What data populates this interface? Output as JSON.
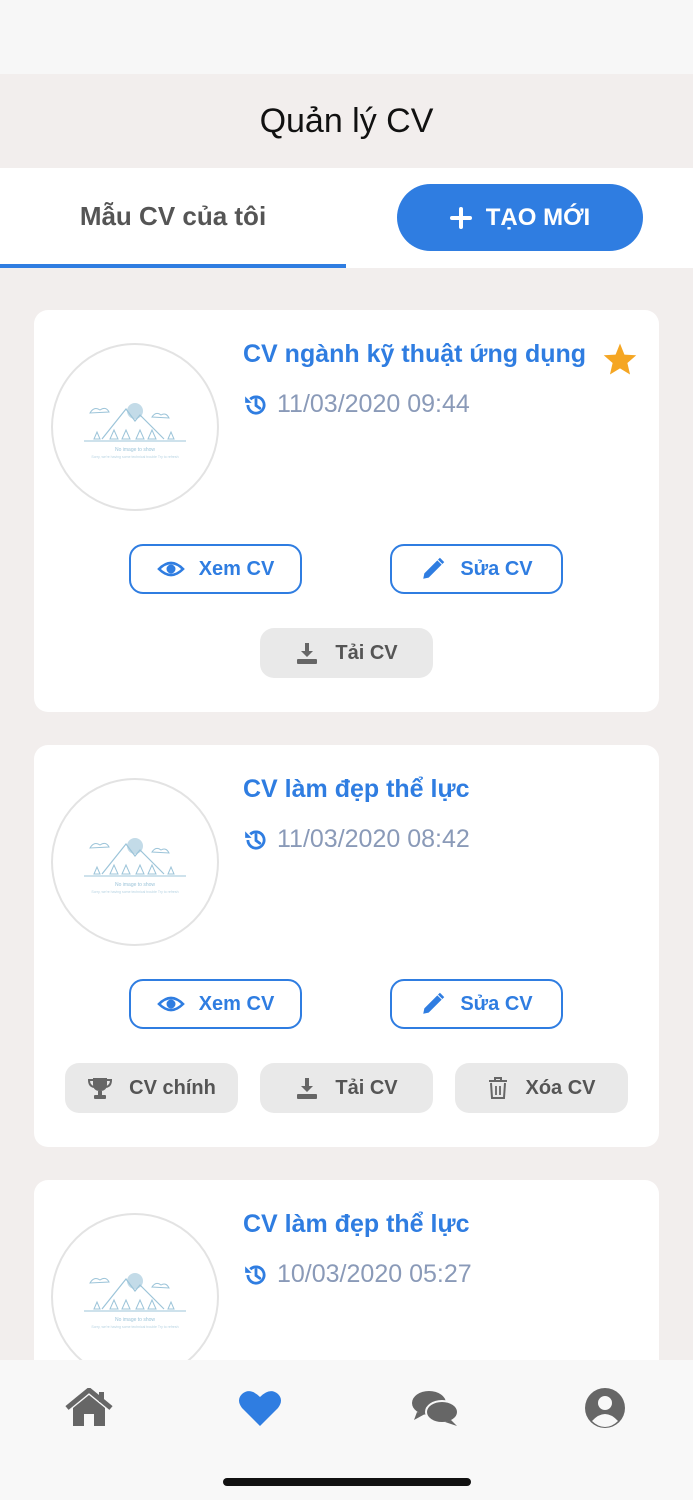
{
  "header": {
    "title": "Quản lý CV"
  },
  "tabs": {
    "my_templates": "Mẫu CV của tôi",
    "create_new": "TẠO MỚI"
  },
  "thumbnail": {
    "caption": "No image to show",
    "subcaption": "Sorry, we're having some technical trouble\nTry to refresh"
  },
  "cards": [
    {
      "title": "CV ngành kỹ thuật ứng dụng",
      "time": "11/03/2020 09:44",
      "starred": true,
      "buttons": {
        "view": "Xem CV",
        "edit": "Sửa CV",
        "download": "Tải CV"
      }
    },
    {
      "title": "CV làm đẹp thể lực",
      "time": "11/03/2020 08:42",
      "starred": false,
      "buttons": {
        "view": "Xem CV",
        "edit": "Sửa CV",
        "main": "CV chính",
        "download": "Tải CV",
        "delete": "Xóa CV"
      }
    },
    {
      "title": "CV làm đẹp thể lực",
      "time": "10/03/2020 05:27",
      "starred": false
    }
  ],
  "nav": [
    "home-icon",
    "heart-icon",
    "chat-icon",
    "user-icon"
  ],
  "colors": {
    "accent": "#2f7de1",
    "star": "#f5a623",
    "background": "#f2eeed",
    "muted_text": "#8a9ab8"
  }
}
